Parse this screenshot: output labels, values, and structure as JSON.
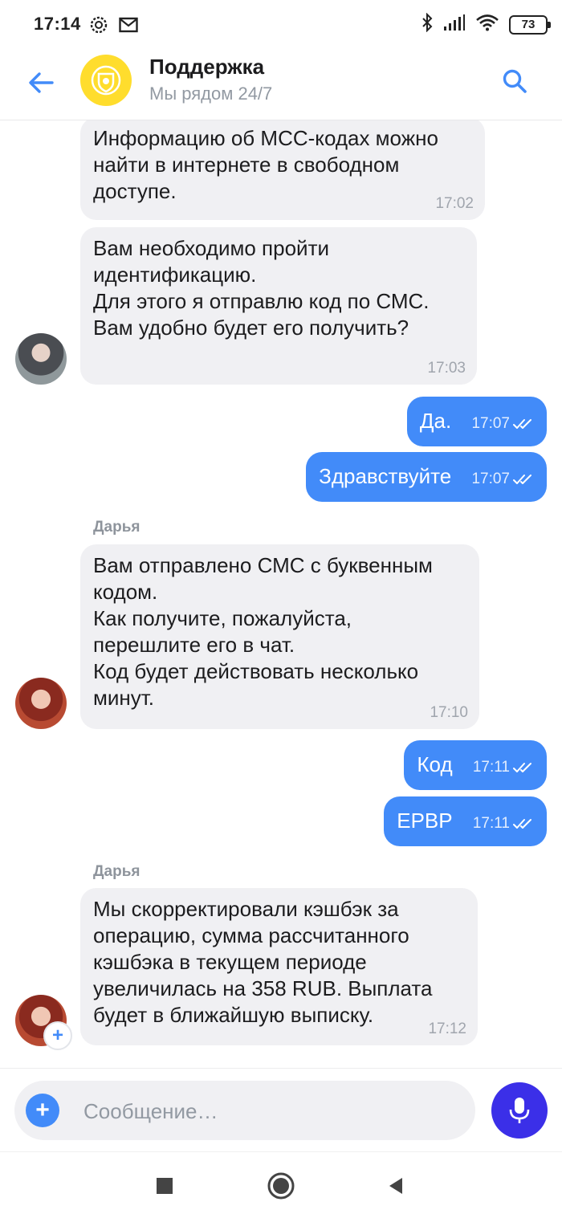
{
  "status": {
    "time": "17:14",
    "battery": "73",
    "left_icons": [
      "settings-gear-icon",
      "mail-icon"
    ],
    "right_icons": [
      "bluetooth-icon",
      "signal-icon",
      "wifi-icon",
      "battery-icon"
    ]
  },
  "header": {
    "title": "Поддержка",
    "subtitle": "Мы рядом 24/7",
    "back_icon": "arrow-left-icon",
    "search_icon": "search-icon"
  },
  "chat": {
    "messages": [
      {
        "direction": "in",
        "text": "Информацию об МСС-кодах можно\nнайти в интернете в свободном\nдоступе.",
        "time": "17:02"
      },
      {
        "direction": "in",
        "text": "Вам необходимо пройти\nидентификацию.\nДля этого я отправлю код по СМС.\nВам удобно будет его получить?",
        "time": "17:03"
      },
      {
        "direction": "out",
        "text": "Да.",
        "time": "17:07"
      },
      {
        "direction": "out",
        "text": "Здравствуйте",
        "time": "17:07"
      },
      {
        "direction": "in",
        "sender": "Дарья",
        "text": "Вам отправлено СМС с буквенным\nкодом.\nКак получите, пожалуйста,\nперешлите его в чат.\nКод будет действовать несколько\nминут.",
        "time": "17:10"
      },
      {
        "direction": "out",
        "text": "Код",
        "time": "17:11"
      },
      {
        "direction": "out",
        "text": "ЕРВР",
        "time": "17:11"
      },
      {
        "direction": "in",
        "sender": "Дарья",
        "text": "Мы скорректировали кэшбэк за\nоперацию, сумма рассчитанного\nкэшбэка в текущем периоде\nувеличилась на 358 RUB. Выплата\nбудет в ближайшую выписку.",
        "time": "17:12"
      }
    ]
  },
  "input": {
    "placeholder": "Сообщение…",
    "value": "",
    "attach_label": "+",
    "add_badge_label": "+"
  },
  "colors": {
    "accent": "#428bf9",
    "incoming_bubble": "#f0f0f3",
    "mic_button": "#3b2fe8",
    "logo_bg": "#ffdd2d"
  }
}
